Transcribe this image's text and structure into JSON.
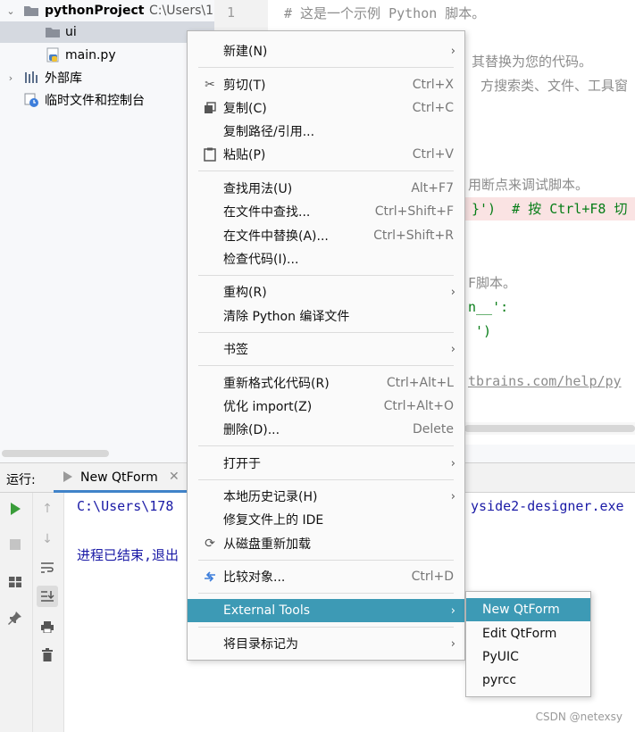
{
  "tree": {
    "project_name": "pythonProject",
    "project_path": "C:\\Users\\1",
    "items": [
      {
        "label": "ui"
      },
      {
        "label": "main.py"
      },
      {
        "label": "外部库"
      },
      {
        "label": "临时文件和控制台"
      }
    ]
  },
  "editor": {
    "line_number": "1",
    "lines": [
      "# 这是一个示例 Python 脚本。",
      "其替换为您的代码。",
      "方搜索类、文件、工具窗",
      "用断点来调试脚本。",
      "}')  # 按 Ctrl+F8 切",
      "F脚本。",
      "n__':",
      "')",
      "tbrains.com/help/py"
    ]
  },
  "run": {
    "label": "运行:",
    "tab": "New QtForm",
    "console_line1_a": "C:\\Users\\178",
    "console_line1_b": "yside2-designer.exe",
    "console_line2": "进程已结束,退出"
  },
  "context_menu": {
    "items": [
      {
        "label": "新建(N)",
        "shortcut": ""
      },
      {
        "label": "剪切(T)",
        "shortcut": "Ctrl+X"
      },
      {
        "label": "复制(C)",
        "shortcut": "Ctrl+C"
      },
      {
        "label": "复制路径/引用...",
        "shortcut": ""
      },
      {
        "label": "粘贴(P)",
        "shortcut": "Ctrl+V"
      },
      {
        "label": "查找用法(U)",
        "shortcut": "Alt+F7"
      },
      {
        "label": "在文件中查找...",
        "shortcut": "Ctrl+Shift+F"
      },
      {
        "label": "在文件中替换(A)...",
        "shortcut": "Ctrl+Shift+R"
      },
      {
        "label": "检查代码(I)...",
        "shortcut": ""
      },
      {
        "label": "重构(R)",
        "shortcut": ""
      },
      {
        "label": "清除 Python 编译文件",
        "shortcut": ""
      },
      {
        "label": "书签",
        "shortcut": ""
      },
      {
        "label": "重新格式化代码(R)",
        "shortcut": "Ctrl+Alt+L"
      },
      {
        "label": "优化 import(Z)",
        "shortcut": "Ctrl+Alt+O"
      },
      {
        "label": "删除(D)...",
        "shortcut": "Delete"
      },
      {
        "label": "打开于",
        "shortcut": ""
      },
      {
        "label": "本地历史记录(H)",
        "shortcut": ""
      },
      {
        "label": "修复文件上的 IDE",
        "shortcut": ""
      },
      {
        "label": "从磁盘重新加载",
        "shortcut": ""
      },
      {
        "label": "比较对象...",
        "shortcut": "Ctrl+D"
      },
      {
        "label": "External Tools",
        "shortcut": ""
      },
      {
        "label": "将目录标记为",
        "shortcut": ""
      }
    ]
  },
  "submenu": {
    "items": [
      {
        "label": "New QtForm"
      },
      {
        "label": "Edit QtForm"
      },
      {
        "label": "PyUIC"
      },
      {
        "label": "pyrcc"
      }
    ]
  },
  "watermark": "CSDN @netexsy",
  "colors": {
    "highlight": "#3d9ab5",
    "menu_bg": "#fafafa",
    "run_green": "#3a9d3a"
  }
}
